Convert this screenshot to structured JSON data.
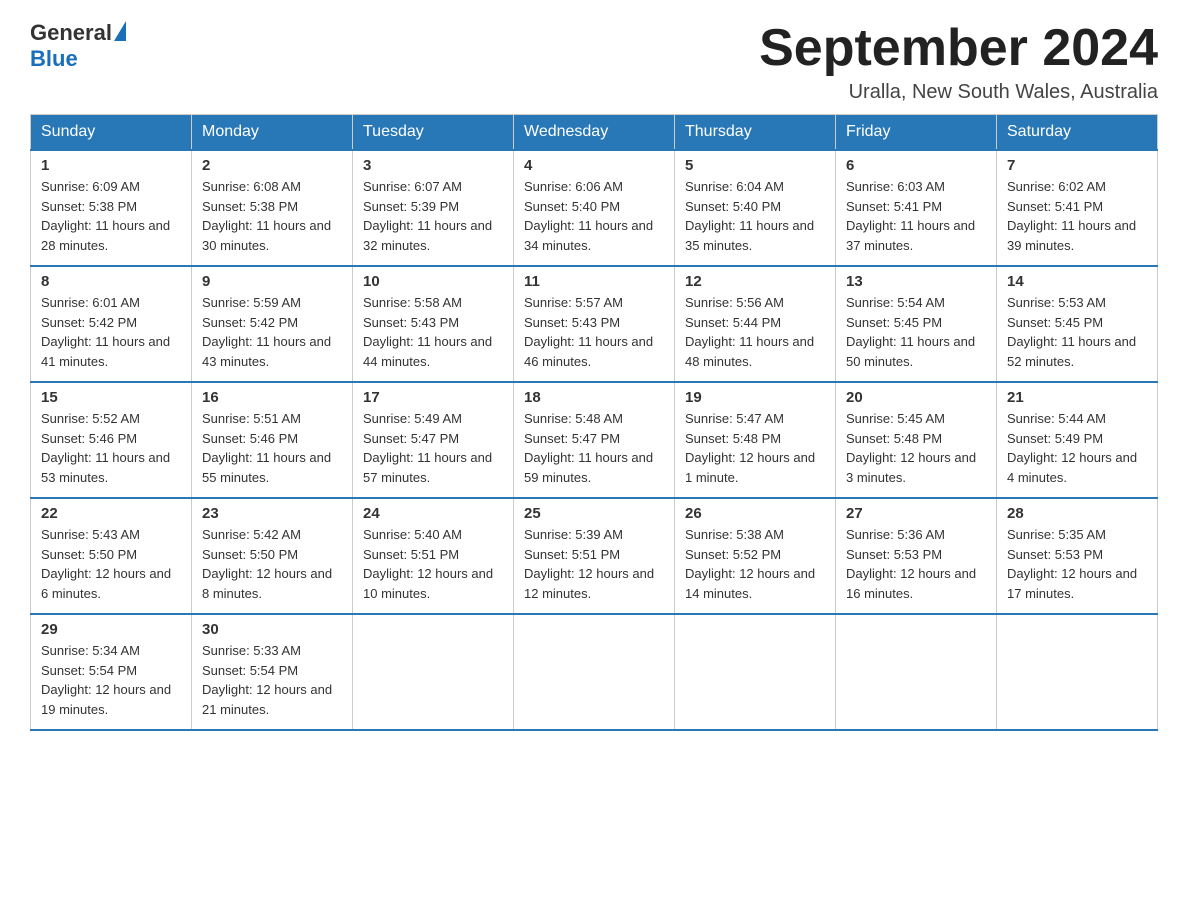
{
  "header": {
    "logo_general": "General",
    "logo_blue": "Blue",
    "month_title": "September 2024",
    "location": "Uralla, New South Wales, Australia"
  },
  "weekdays": [
    "Sunday",
    "Monday",
    "Tuesday",
    "Wednesday",
    "Thursday",
    "Friday",
    "Saturday"
  ],
  "weeks": [
    [
      {
        "day": "1",
        "sunrise": "6:09 AM",
        "sunset": "5:38 PM",
        "daylight": "11 hours and 28 minutes."
      },
      {
        "day": "2",
        "sunrise": "6:08 AM",
        "sunset": "5:38 PM",
        "daylight": "11 hours and 30 minutes."
      },
      {
        "day": "3",
        "sunrise": "6:07 AM",
        "sunset": "5:39 PM",
        "daylight": "11 hours and 32 minutes."
      },
      {
        "day": "4",
        "sunrise": "6:06 AM",
        "sunset": "5:40 PM",
        "daylight": "11 hours and 34 minutes."
      },
      {
        "day": "5",
        "sunrise": "6:04 AM",
        "sunset": "5:40 PM",
        "daylight": "11 hours and 35 minutes."
      },
      {
        "day": "6",
        "sunrise": "6:03 AM",
        "sunset": "5:41 PM",
        "daylight": "11 hours and 37 minutes."
      },
      {
        "day": "7",
        "sunrise": "6:02 AM",
        "sunset": "5:41 PM",
        "daylight": "11 hours and 39 minutes."
      }
    ],
    [
      {
        "day": "8",
        "sunrise": "6:01 AM",
        "sunset": "5:42 PM",
        "daylight": "11 hours and 41 minutes."
      },
      {
        "day": "9",
        "sunrise": "5:59 AM",
        "sunset": "5:42 PM",
        "daylight": "11 hours and 43 minutes."
      },
      {
        "day": "10",
        "sunrise": "5:58 AM",
        "sunset": "5:43 PM",
        "daylight": "11 hours and 44 minutes."
      },
      {
        "day": "11",
        "sunrise": "5:57 AM",
        "sunset": "5:43 PM",
        "daylight": "11 hours and 46 minutes."
      },
      {
        "day": "12",
        "sunrise": "5:56 AM",
        "sunset": "5:44 PM",
        "daylight": "11 hours and 48 minutes."
      },
      {
        "day": "13",
        "sunrise": "5:54 AM",
        "sunset": "5:45 PM",
        "daylight": "11 hours and 50 minutes."
      },
      {
        "day": "14",
        "sunrise": "5:53 AM",
        "sunset": "5:45 PM",
        "daylight": "11 hours and 52 minutes."
      }
    ],
    [
      {
        "day": "15",
        "sunrise": "5:52 AM",
        "sunset": "5:46 PM",
        "daylight": "11 hours and 53 minutes."
      },
      {
        "day": "16",
        "sunrise": "5:51 AM",
        "sunset": "5:46 PM",
        "daylight": "11 hours and 55 minutes."
      },
      {
        "day": "17",
        "sunrise": "5:49 AM",
        "sunset": "5:47 PM",
        "daylight": "11 hours and 57 minutes."
      },
      {
        "day": "18",
        "sunrise": "5:48 AM",
        "sunset": "5:47 PM",
        "daylight": "11 hours and 59 minutes."
      },
      {
        "day": "19",
        "sunrise": "5:47 AM",
        "sunset": "5:48 PM",
        "daylight": "12 hours and 1 minute."
      },
      {
        "day": "20",
        "sunrise": "5:45 AM",
        "sunset": "5:48 PM",
        "daylight": "12 hours and 3 minutes."
      },
      {
        "day": "21",
        "sunrise": "5:44 AM",
        "sunset": "5:49 PM",
        "daylight": "12 hours and 4 minutes."
      }
    ],
    [
      {
        "day": "22",
        "sunrise": "5:43 AM",
        "sunset": "5:50 PM",
        "daylight": "12 hours and 6 minutes."
      },
      {
        "day": "23",
        "sunrise": "5:42 AM",
        "sunset": "5:50 PM",
        "daylight": "12 hours and 8 minutes."
      },
      {
        "day": "24",
        "sunrise": "5:40 AM",
        "sunset": "5:51 PM",
        "daylight": "12 hours and 10 minutes."
      },
      {
        "day": "25",
        "sunrise": "5:39 AM",
        "sunset": "5:51 PM",
        "daylight": "12 hours and 12 minutes."
      },
      {
        "day": "26",
        "sunrise": "5:38 AM",
        "sunset": "5:52 PM",
        "daylight": "12 hours and 14 minutes."
      },
      {
        "day": "27",
        "sunrise": "5:36 AM",
        "sunset": "5:53 PM",
        "daylight": "12 hours and 16 minutes."
      },
      {
        "day": "28",
        "sunrise": "5:35 AM",
        "sunset": "5:53 PM",
        "daylight": "12 hours and 17 minutes."
      }
    ],
    [
      {
        "day": "29",
        "sunrise": "5:34 AM",
        "sunset": "5:54 PM",
        "daylight": "12 hours and 19 minutes."
      },
      {
        "day": "30",
        "sunrise": "5:33 AM",
        "sunset": "5:54 PM",
        "daylight": "12 hours and 21 minutes."
      },
      null,
      null,
      null,
      null,
      null
    ]
  ]
}
